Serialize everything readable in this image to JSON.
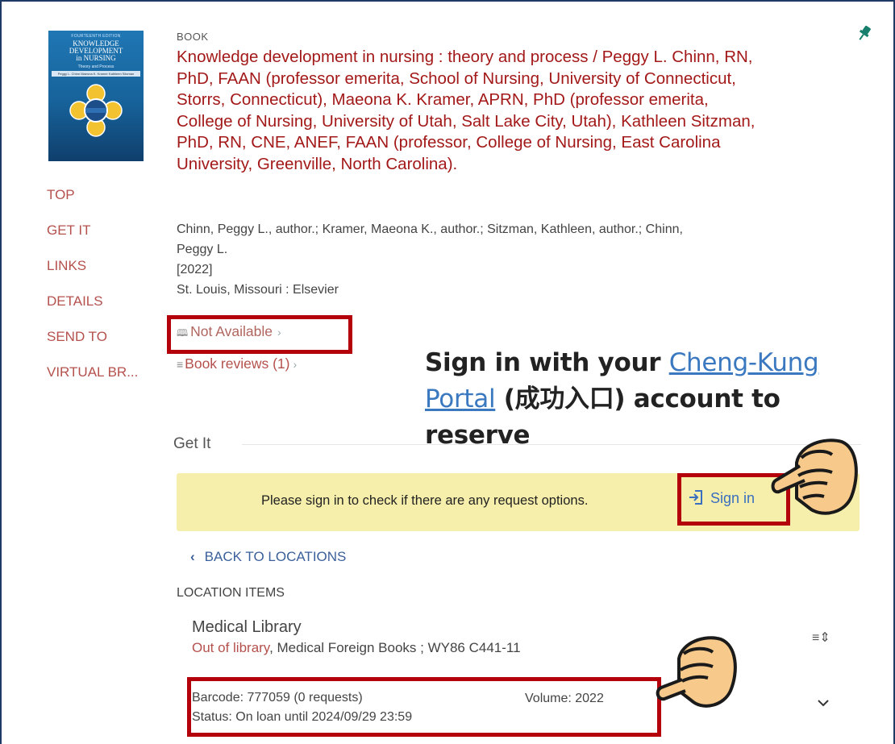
{
  "cover": {
    "edition": "FOURTEENTH EDITION",
    "title_lines": [
      "KNOWLEDGE",
      "DEVELOPMENT",
      "in NURSING"
    ],
    "subtitle": "Theory and Process",
    "authors": "Peggy L. Chinn  Maeona K. Kramer  Kathleen Sitzman"
  },
  "sidenav": [
    "TOP",
    "GET IT",
    "LINKS",
    "DETAILS",
    "SEND TO",
    "VIRTUAL BR..."
  ],
  "record": {
    "type": "BOOK",
    "title": "Knowledge development in nursing : theory and process / Peggy L. Chinn, RN, PhD, FAAN (professor emerita, School of Nursing, University of Connecticut, Storrs, Connecticut), Maeona K. Kramer, APRN, PhD (professor emerita, College of Nursing, University of Utah, Salt Lake City, Utah), Kathleen Sitzman, PhD, RN, CNE, ANEF, FAAN (professor, College of Nursing, East Carolina University, Greenville, North Carolina).",
    "authors_line1": "Chinn, Peggy L., author.; Kramer, Maeona K., author.; Sitzman, Kathleen, author.; Chinn,",
    "authors_line2": "Peggy L.",
    "date": "[2022]",
    "publisher": "St. Louis, Missouri : Elsevier",
    "availability": "Not Available",
    "reviews": "Book reviews (1)"
  },
  "instruction": {
    "prefix": "Sign in with your ",
    "link_part1": "Cheng-Kung",
    "link_part2": "Portal",
    "suffix1": " (成功入口) account to",
    "suffix2": "reserve"
  },
  "get_it": {
    "heading": "Get It",
    "signin_message": "Please sign in to check if there are any request options.",
    "signin_button": "Sign in",
    "back_to_locations": "BACK TO LOCATIONS",
    "location_items_label": "LOCATION ITEMS",
    "library_name": "Medical Library",
    "out_of_library": "Out of library",
    "location_detail": ", Medical Foreign Books ; WY86 C441-11",
    "barcode": "Barcode: 777059 (0 requests)",
    "status": "Status: On loan until 2024/09/29 23:59",
    "volume": "Volume: 2022"
  },
  "colors": {
    "highlight": "#b3000b",
    "title": "#a31919",
    "nav": "#b5514d",
    "signin_bar": "#f6efab",
    "link": "#3a78c0"
  }
}
